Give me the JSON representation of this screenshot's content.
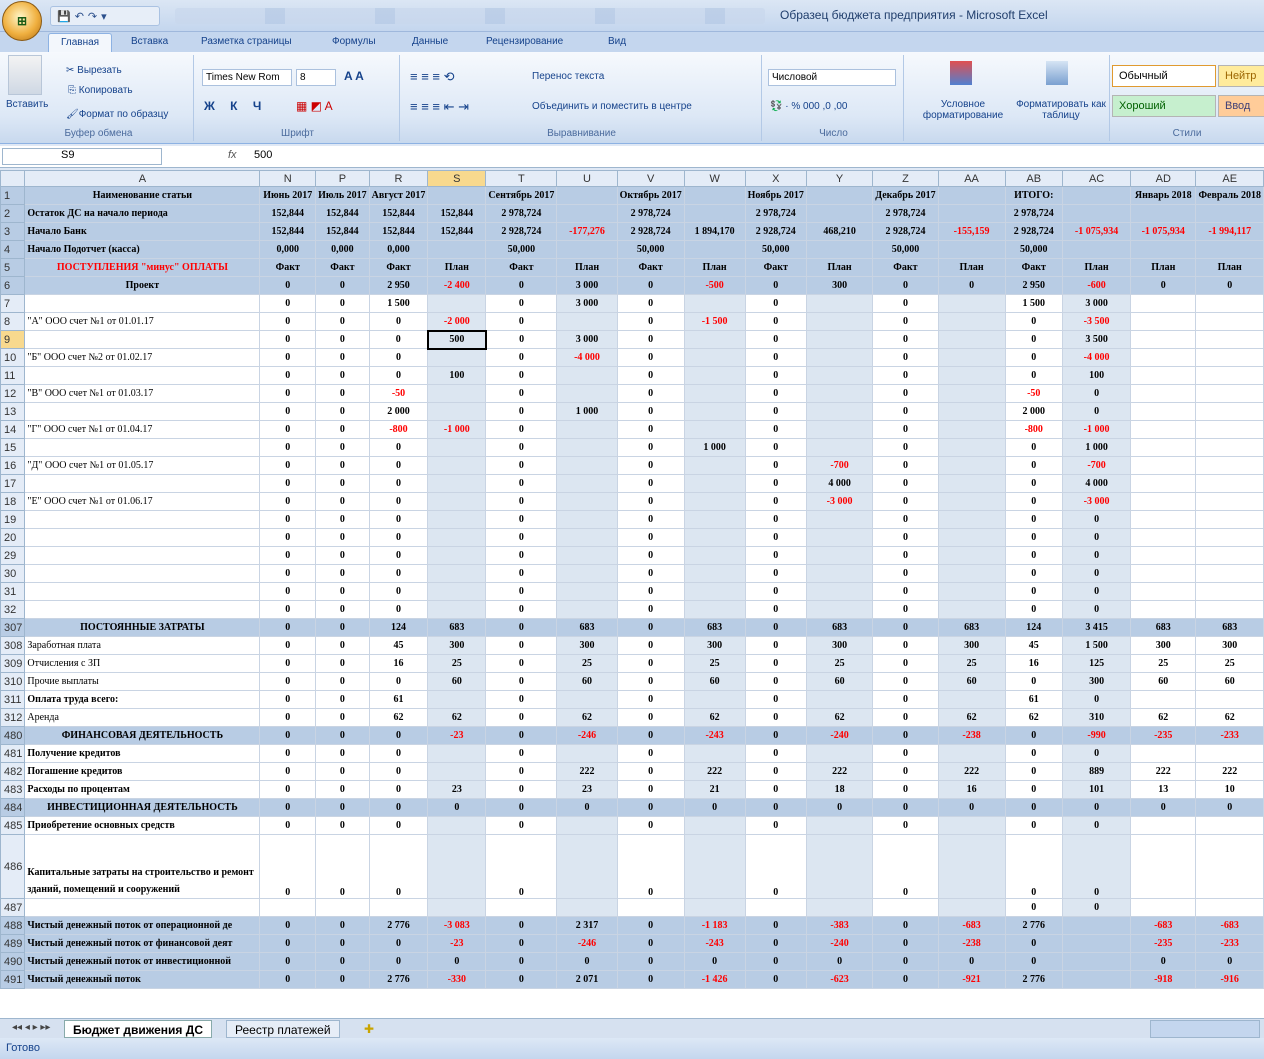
{
  "title": "Образец бюджета предприятия - Microsoft Excel",
  "office_label": "",
  "ribbon_tabs": [
    "Главная",
    "Вставка",
    "Разметка страницы",
    "Формулы",
    "Данные",
    "Рецензирование",
    "Вид"
  ],
  "ribbon": {
    "paste": "Вставить",
    "cut": "Вырезать",
    "copy": "Копировать",
    "format_painter": "Формат по образцу",
    "clipboard": "Буфер обмена",
    "font_name": "Times New Rom",
    "font_size": "8",
    "font_group": "Шрифт",
    "wrap": "Перенос текста",
    "merge": "Объединить и поместить в центре",
    "align_group": "Выравнивание",
    "number_format": "Числовой",
    "number_group": "Число",
    "cond": "Условное форматирование",
    "as_table": "Форматировать как таблицу",
    "style_normal": "Обычный",
    "style_neutral": "Нейтр",
    "style_good": "Хороший",
    "style_input": "Ввод",
    "styles_group": "Стили"
  },
  "namebox": "S9",
  "formula": "500",
  "columns": [
    "A",
    "N",
    "P",
    "R",
    "S",
    "T",
    "U",
    "V",
    "W",
    "X",
    "Y",
    "Z",
    "AA",
    "AB",
    "AC",
    "AD",
    "AE"
  ],
  "rows": [
    {
      "r": "1",
      "cls": "hdr",
      "c": [
        "Наименование статьи",
        "Июнь 2017",
        "Июль 2017",
        "Август 2017",
        "",
        "Сентябрь 2017",
        "",
        "Октябрь 2017",
        "",
        "Ноябрь 2017",
        "",
        "Декабрь 2017",
        "",
        "ИТОГО:",
        "",
        "Январь 2018",
        "Февраль 2018"
      ]
    },
    {
      "r": "2",
      "cls": "hdr",
      "c": [
        "Остаток ДС на начало периода",
        "152,844",
        "152,844",
        "152,844",
        "152,844",
        "2 978,724",
        "",
        "2 978,724",
        "",
        "2 978,724",
        "",
        "2 978,724",
        "",
        "2 978,724",
        "",
        "",
        ""
      ]
    },
    {
      "r": "3",
      "cls": "hdr",
      "c": [
        "Начало Банк",
        "152,844",
        "152,844",
        "152,844",
        "152,844",
        "2 928,724",
        "-177,276",
        "2 928,724",
        "1 894,170",
        "2 928,724",
        "468,210",
        "2 928,724",
        "-155,159",
        "2 928,724",
        "-1 075,934",
        "-1 075,934",
        "-1 994,117"
      ]
    },
    {
      "r": "4",
      "cls": "hdr",
      "c": [
        "Начало Подотчет (касса)",
        "0,000",
        "0,000",
        "0,000",
        "",
        "50,000",
        "",
        "50,000",
        "",
        "50,000",
        "",
        "50,000",
        "",
        "50,000",
        "",
        "",
        ""
      ]
    },
    {
      "r": "5",
      "cls": "hdr",
      "c": [
        "ПОСТУПЛЕНИЯ \"минус\" ОПЛАТЫ",
        "Факт",
        "Факт",
        "Факт",
        "План",
        "Факт",
        "План",
        "Факт",
        "План",
        "Факт",
        "План",
        "Факт",
        "План",
        "Факт",
        "План",
        "План",
        "План"
      ]
    },
    {
      "r": "6",
      "cls": "hdr",
      "c": [
        "Проект",
        "0",
        "0",
        "2 950",
        "-2 400",
        "0",
        "3 000",
        "0",
        "-500",
        "0",
        "300",
        "0",
        "0",
        "2 950",
        "-600",
        "0",
        "0"
      ]
    },
    {
      "r": "7",
      "cls": "",
      "c": [
        "",
        "0",
        "0",
        "1 500",
        "",
        "0",
        "3 000",
        "0",
        "",
        "0",
        "",
        "0",
        "",
        "1 500",
        "3 000",
        "",
        ""
      ]
    },
    {
      "r": "8",
      "cls": "",
      "c": [
        "\"А\" ООО счет №1 от 01.01.17",
        "0",
        "0",
        "0",
        "-2 000",
        "0",
        "",
        "0",
        "-1 500",
        "0",
        "",
        "0",
        "",
        "0",
        "-3 500",
        "",
        ""
      ]
    },
    {
      "r": "9",
      "cls": "",
      "c": [
        "",
        "0",
        "0",
        "0",
        "500",
        "0",
        "3 000",
        "0",
        "",
        "0",
        "",
        "0",
        "",
        "0",
        "3 500",
        "",
        ""
      ]
    },
    {
      "r": "10",
      "cls": "",
      "c": [
        "\"Б\" ООО счет №2 от 01.02.17",
        "0",
        "0",
        "0",
        "",
        "0",
        "-4 000",
        "0",
        "",
        "0",
        "",
        "0",
        "",
        "0",
        "-4 000",
        "",
        ""
      ]
    },
    {
      "r": "11",
      "cls": "",
      "c": [
        "",
        "0",
        "0",
        "0",
        "100",
        "0",
        "",
        "0",
        "",
        "0",
        "",
        "0",
        "",
        "0",
        "100",
        "",
        ""
      ]
    },
    {
      "r": "12",
      "cls": "",
      "c": [
        "\"В\" ООО счет №1 от 01.03.17",
        "0",
        "0",
        "-50",
        "",
        "0",
        "",
        "0",
        "",
        "0",
        "",
        "0",
        "",
        "-50",
        "0",
        "",
        ""
      ]
    },
    {
      "r": "13",
      "cls": "",
      "c": [
        "",
        "0",
        "0",
        "2 000",
        "",
        "0",
        "1 000",
        "0",
        "",
        "0",
        "",
        "0",
        "",
        "2 000",
        "0",
        "",
        ""
      ]
    },
    {
      "r": "14",
      "cls": "",
      "c": [
        "\"Г\" ООО счет №1 от 01.04.17",
        "0",
        "0",
        "-800",
        "-1 000",
        "0",
        "",
        "0",
        "",
        "0",
        "",
        "0",
        "",
        "-800",
        "-1 000",
        "",
        ""
      ]
    },
    {
      "r": "15",
      "cls": "",
      "c": [
        "",
        "0",
        "0",
        "0",
        "",
        "0",
        "",
        "0",
        "1 000",
        "0",
        "",
        "0",
        "",
        "0",
        "1 000",
        "",
        ""
      ]
    },
    {
      "r": "16",
      "cls": "",
      "c": [
        "\"Д\" ООО счет №1 от 01.05.17",
        "0",
        "0",
        "0",
        "",
        "0",
        "",
        "0",
        "",
        "0",
        "-700",
        "0",
        "",
        "0",
        "-700",
        "",
        ""
      ]
    },
    {
      "r": "17",
      "cls": "",
      "c": [
        "",
        "0",
        "0",
        "0",
        "",
        "0",
        "",
        "0",
        "",
        "0",
        "4 000",
        "0",
        "",
        "0",
        "4 000",
        "",
        ""
      ]
    },
    {
      "r": "18",
      "cls": "",
      "c": [
        "\"Е\" ООО счет №1 от 01.06.17",
        "0",
        "0",
        "0",
        "",
        "0",
        "",
        "0",
        "",
        "0",
        "-3 000",
        "0",
        "",
        "0",
        "-3 000",
        "",
        ""
      ]
    },
    {
      "r": "19",
      "cls": "",
      "c": [
        "",
        "0",
        "0",
        "0",
        "",
        "0",
        "",
        "0",
        "",
        "0",
        "",
        "0",
        "",
        "0",
        "0",
        "",
        ""
      ]
    },
    {
      "r": "20",
      "cls": "",
      "c": [
        "",
        "0",
        "0",
        "0",
        "",
        "0",
        "",
        "0",
        "",
        "0",
        "",
        "0",
        "",
        "0",
        "0",
        "",
        ""
      ]
    },
    {
      "r": "29",
      "cls": "",
      "c": [
        "",
        "0",
        "0",
        "0",
        "",
        "0",
        "",
        "0",
        "",
        "0",
        "",
        "0",
        "",
        "0",
        "0",
        "",
        ""
      ]
    },
    {
      "r": "30",
      "cls": "",
      "c": [
        "",
        "0",
        "0",
        "0",
        "",
        "0",
        "",
        "0",
        "",
        "0",
        "",
        "0",
        "",
        "0",
        "0",
        "",
        ""
      ]
    },
    {
      "r": "31",
      "cls": "",
      "c": [
        "",
        "0",
        "0",
        "0",
        "",
        "0",
        "",
        "0",
        "",
        "0",
        "",
        "0",
        "",
        "0",
        "0",
        "",
        ""
      ]
    },
    {
      "r": "32",
      "cls": "",
      "c": [
        "",
        "0",
        "0",
        "0",
        "",
        "0",
        "",
        "0",
        "",
        "0",
        "",
        "0",
        "",
        "0",
        "0",
        "",
        ""
      ]
    },
    {
      "r": "307",
      "cls": "sec",
      "c": [
        "ПОСТОЯННЫЕ ЗАТРАТЫ",
        "0",
        "0",
        "124",
        "683",
        "0",
        "683",
        "0",
        "683",
        "0",
        "683",
        "0",
        "683",
        "124",
        "3 415",
        "683",
        "683"
      ]
    },
    {
      "r": "308",
      "cls": "",
      "c": [
        "Заработная плата",
        "0",
        "0",
        "45",
        "300",
        "0",
        "300",
        "0",
        "300",
        "0",
        "300",
        "0",
        "300",
        "45",
        "1 500",
        "300",
        "300"
      ]
    },
    {
      "r": "309",
      "cls": "",
      "c": [
        "Отчисления с ЗП",
        "0",
        "0",
        "16",
        "25",
        "0",
        "25",
        "0",
        "25",
        "0",
        "25",
        "0",
        "25",
        "16",
        "125",
        "25",
        "25"
      ]
    },
    {
      "r": "310",
      "cls": "",
      "c": [
        "Прочие выплаты",
        "0",
        "0",
        "0",
        "60",
        "0",
        "60",
        "0",
        "60",
        "0",
        "60",
        "0",
        "60",
        "0",
        "300",
        "60",
        "60"
      ]
    },
    {
      "r": "311",
      "cls": "b",
      "c": [
        "Оплата труда всего:",
        "0",
        "0",
        "61",
        "",
        "0",
        "",
        "0",
        "",
        "0",
        "",
        "0",
        "",
        "61",
        "0",
        "",
        ""
      ]
    },
    {
      "r": "312",
      "cls": "",
      "c": [
        "Аренда",
        "0",
        "0",
        "62",
        "62",
        "0",
        "62",
        "0",
        "62",
        "0",
        "62",
        "0",
        "62",
        "62",
        "310",
        "62",
        "62"
      ]
    },
    {
      "r": "480",
      "cls": "sec",
      "c": [
        "ФИНАНСОВАЯ ДЕЯТЕЛЬНОСТЬ",
        "0",
        "0",
        "0",
        "-23",
        "0",
        "-246",
        "0",
        "-243",
        "0",
        "-240",
        "0",
        "-238",
        "0",
        "-990",
        "-235",
        "-233"
      ]
    },
    {
      "r": "481",
      "cls": "b",
      "c": [
        "Получение  кредитов",
        "0",
        "0",
        "0",
        "",
        "0",
        "",
        "0",
        "",
        "0",
        "",
        "0",
        "",
        "0",
        "0",
        "",
        ""
      ]
    },
    {
      "r": "482",
      "cls": "b",
      "c": [
        "Погашение кредитов",
        "0",
        "0",
        "0",
        "",
        "0",
        "222",
        "0",
        "222",
        "0",
        "222",
        "0",
        "222",
        "0",
        "889",
        "222",
        "222"
      ]
    },
    {
      "r": "483",
      "cls": "b",
      "c": [
        "Расходы по процентам",
        "0",
        "0",
        "0",
        "23",
        "0",
        "23",
        "0",
        "21",
        "0",
        "18",
        "0",
        "16",
        "0",
        "101",
        "13",
        "10"
      ]
    },
    {
      "r": "484",
      "cls": "sec",
      "c": [
        "ИНВЕСТИЦИОННАЯ ДЕЯТЕЛЬНОСТЬ",
        "0",
        "0",
        "0",
        "0",
        "0",
        "0",
        "0",
        "0",
        "0",
        "0",
        "0",
        "0",
        "0",
        "0",
        "0",
        "0"
      ]
    },
    {
      "r": "485",
      "cls": "b",
      "c": [
        "Приобретение основных средств",
        "0",
        "0",
        "0",
        "",
        "0",
        "",
        "0",
        "",
        "0",
        "",
        "0",
        "",
        "0",
        "0",
        "",
        ""
      ]
    },
    {
      "r": "486",
      "cls": "b tall",
      "c": [
        "Капитальные затраты на строительство и ремонт зданий, помещений и сооружений",
        "0",
        "0",
        "0",
        "",
        "0",
        "",
        "0",
        "",
        "0",
        "",
        "0",
        "",
        "0",
        "0",
        "",
        ""
      ]
    },
    {
      "r": "487",
      "cls": "",
      "c": [
        "",
        "",
        "",
        "",
        "",
        "",
        "",
        "",
        "",
        "",
        "",
        "",
        "",
        "0",
        "0",
        "",
        ""
      ]
    },
    {
      "r": "488",
      "cls": "sec",
      "c": [
        "Чистый денежный поток от операционной де",
        "0",
        "0",
        "2 776",
        "-3 083",
        "0",
        "2 317",
        "0",
        "-1 183",
        "0",
        "-383",
        "0",
        "-683",
        "2 776",
        "",
        "-683",
        "-683"
      ]
    },
    {
      "r": "489",
      "cls": "sec",
      "c": [
        "Чистый денежный поток от финансовой деят",
        "0",
        "0",
        "0",
        "-23",
        "0",
        "-246",
        "0",
        "-243",
        "0",
        "-240",
        "0",
        "-238",
        "0",
        "",
        "-235",
        "-233"
      ]
    },
    {
      "r": "490",
      "cls": "sec",
      "c": [
        "Чистый денежный поток от инвестиционной",
        "0",
        "0",
        "0",
        "0",
        "0",
        "0",
        "0",
        "0",
        "0",
        "0",
        "0",
        "0",
        "0",
        "",
        "0",
        "0"
      ]
    },
    {
      "r": "491",
      "cls": "sec",
      "c": [
        "Чистый денежный поток",
        "0",
        "0",
        "2 776",
        "-330",
        "0",
        "2 071",
        "0",
        "-1 426",
        "0",
        "-623",
        "0",
        "-921",
        "2 776",
        "",
        "-918",
        "-916"
      ]
    }
  ],
  "sheets": [
    "Бюджет движения ДС",
    "Реестр платежей"
  ],
  "status": "Готово"
}
